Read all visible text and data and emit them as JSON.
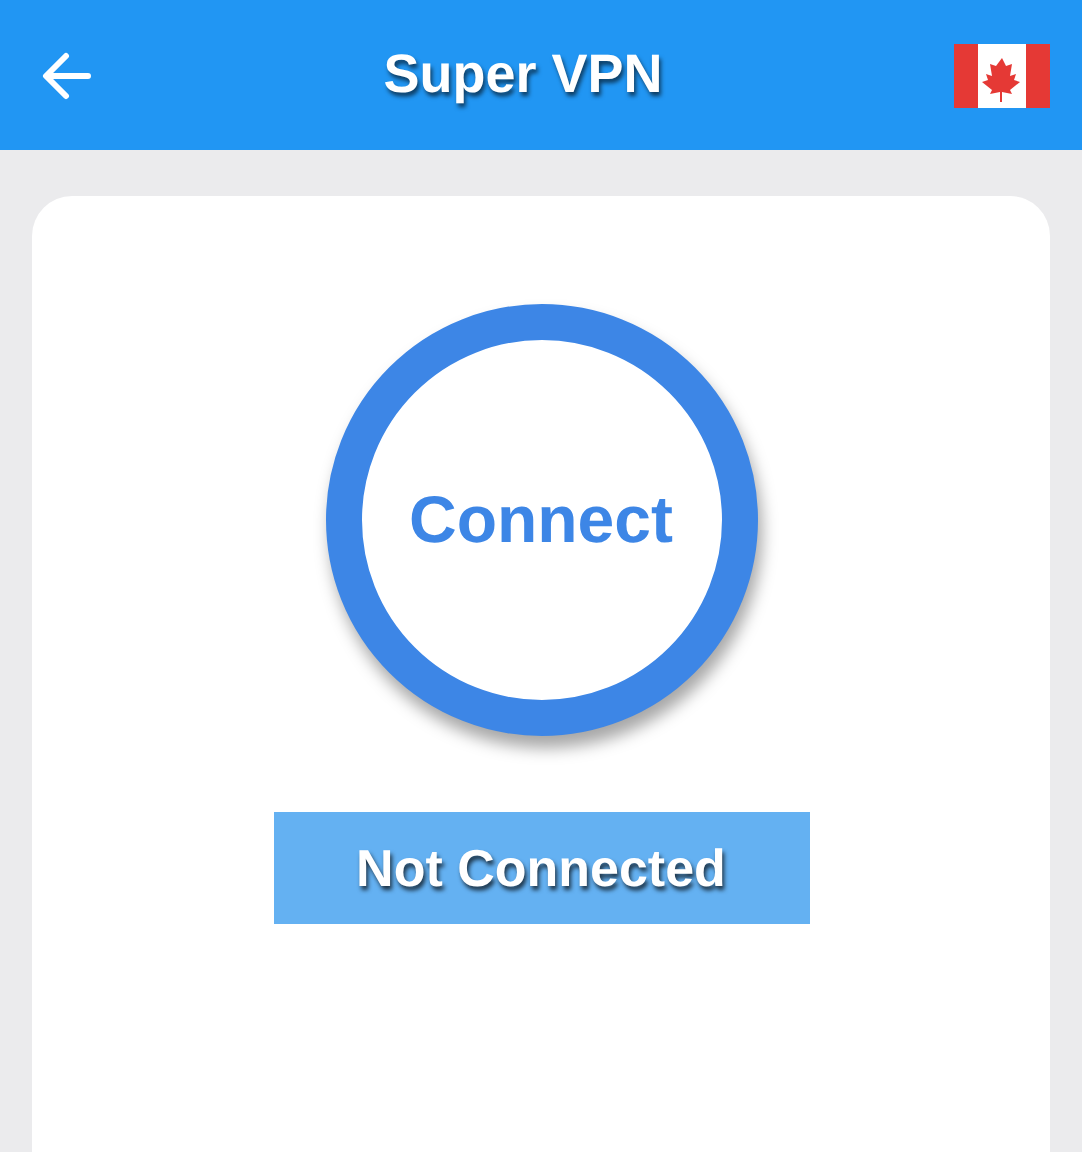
{
  "app_bar": {
    "title": "Super VPN"
  },
  "connect_button": {
    "label": "Connect"
  },
  "status": {
    "text": "Not Connected"
  }
}
